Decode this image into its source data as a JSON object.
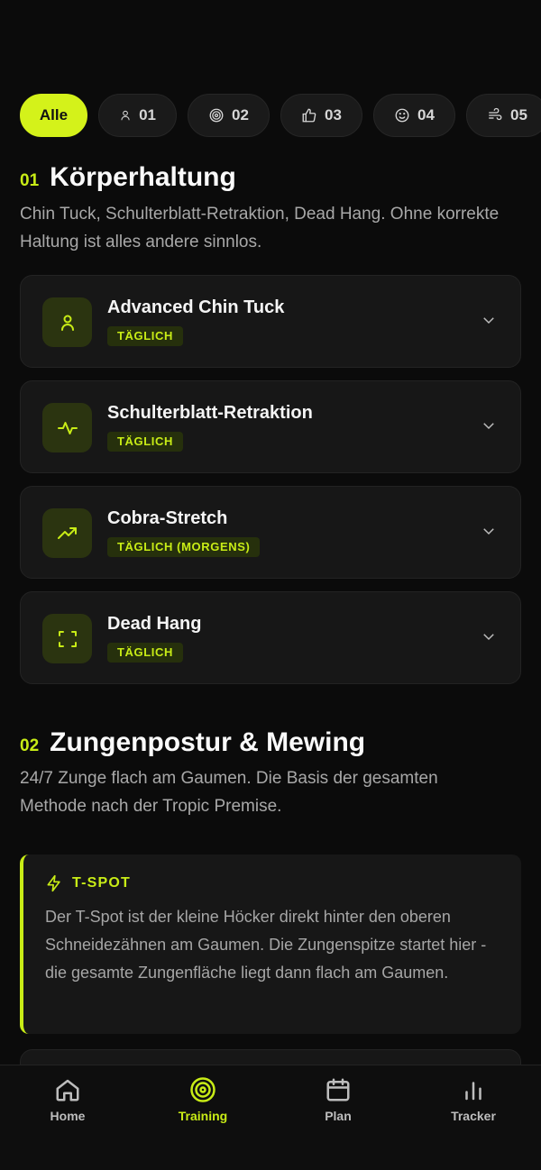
{
  "filters": [
    {
      "label": "Alle",
      "icon": null,
      "active": true
    },
    {
      "label": "01",
      "icon": "person-icon"
    },
    {
      "label": "02",
      "icon": "target-icon"
    },
    {
      "label": "03",
      "icon": "thumbs-up-icon"
    },
    {
      "label": "04",
      "icon": "smile-icon"
    },
    {
      "label": "05",
      "icon": "wind-icon"
    }
  ],
  "section1": {
    "num": "01",
    "title": "Körperhaltung",
    "desc": "Chin Tuck, Schulterblatt-Retraktion, Dead Hang. Ohne korrekte Haltung ist alles andere sinnlos.",
    "exercises": [
      {
        "name": "Advanced Chin Tuck",
        "badge": "TÄGLICH",
        "icon": "person-icon"
      },
      {
        "name": "Schulterblatt-Retraktion",
        "badge": "TÄGLICH",
        "icon": "pulse-icon"
      },
      {
        "name": "Cobra-Stretch",
        "badge": "TÄGLICH (MORGENS)",
        "icon": "trending-up-icon"
      },
      {
        "name": "Dead Hang",
        "badge": "TÄGLICH",
        "icon": "scan-icon"
      }
    ]
  },
  "section2": {
    "num": "02",
    "title": "Zungenpostur & Mewing",
    "desc": "24/7 Zunge flach am Gaumen. Die Basis der gesamten Methode nach der Tropic Premise.",
    "tip": {
      "title": "T-SPOT",
      "text": "Der T-Spot ist der kleine Höcker direkt hinter den oberen Schneidezähnen am Gaumen. Die Zungenspitze startet hier - die gesamte Zungenfläche liegt dann flach am Gaumen."
    }
  },
  "nav": [
    {
      "label": "Home",
      "icon": "home-icon"
    },
    {
      "label": "Training",
      "icon": "target-icon",
      "active": true
    },
    {
      "label": "Plan",
      "icon": "calendar-icon"
    },
    {
      "label": "Tracker",
      "icon": "bar-chart-icon"
    }
  ],
  "colors": {
    "accent": "#c8ec16",
    "chip_active": "#d4f21a",
    "background": "#0b0b0b",
    "card": "#171717"
  }
}
